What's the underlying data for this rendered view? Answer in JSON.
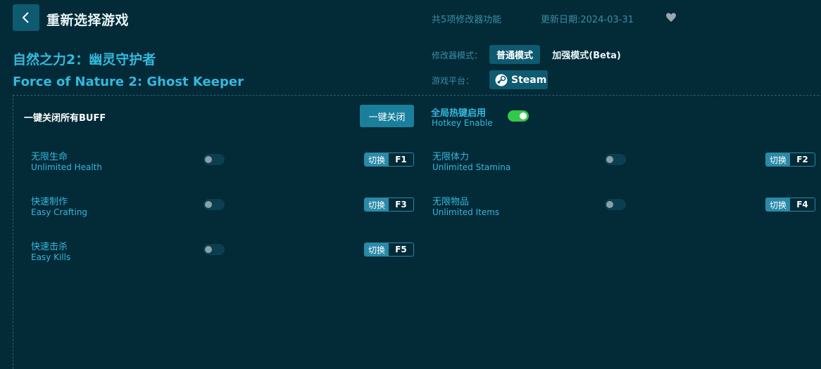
{
  "header": {
    "title": "重新选择游戏",
    "feature_count": "共5项修改器功能",
    "update_date": "更新日期:2024-03-31"
  },
  "game": {
    "title_cn": "自然之力2：幽灵守护者",
    "title_en": "Force of Nature 2: Ghost Keeper"
  },
  "mode": {
    "label": "修改器模式：",
    "normal": "普通模式",
    "beta": "加强模式(Beta)"
  },
  "platform": {
    "label": "游戏平台：",
    "name": "Steam"
  },
  "buff": {
    "label": "一键关闭所有BUFF",
    "button": "一键关闭"
  },
  "hotkey": {
    "label_cn": "全局热键启用",
    "label_en": "Hotkey Enable",
    "enabled": true
  },
  "switch_label": "切换",
  "features": [
    {
      "cn": "无限生命",
      "en": "Unlimited Health",
      "key": "F1",
      "on": false
    },
    {
      "cn": "无限体力",
      "en": "Unlimited Stamina",
      "key": "F2",
      "on": false
    },
    {
      "cn": "快速制作",
      "en": "Easy Crafting",
      "key": "F3",
      "on": false
    },
    {
      "cn": "无限物品",
      "en": "Unlimited Items",
      "key": "F4",
      "on": false
    },
    {
      "cn": "快速击杀",
      "en": "Easy Kills",
      "key": "F5",
      "on": false
    }
  ],
  "colors": {
    "background": "#022a37",
    "accent": "#35b8de",
    "button": "#0e5a70",
    "toggle_on": "#32c84a"
  }
}
